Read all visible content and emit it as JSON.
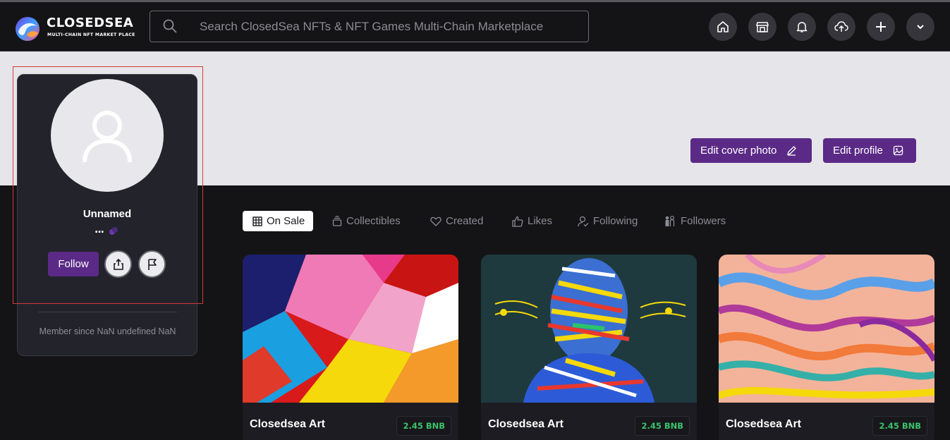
{
  "header": {
    "logo_title": "CLOSEDSEA",
    "logo_subtitle": "MULTI-CHAIN NFT MARKET PLACE",
    "search_placeholder": "Search ClosedSea NFTs & NFT Games Multi-Chain Marketplace",
    "nav_icons": [
      "home-icon",
      "store-icon",
      "bell-icon",
      "upload-cloud-icon",
      "plus-icon",
      "chevron-down-icon"
    ]
  },
  "cover": {
    "edit_cover_label": "Edit cover photo",
    "edit_profile_label": "Edit profile"
  },
  "profile": {
    "name": "Unnamed",
    "address": "...",
    "follow_label": "Follow",
    "member_since": "Member since NaN undefined NaN"
  },
  "tabs": [
    {
      "label": "On Sale",
      "icon": "grid-icon",
      "active": true
    },
    {
      "label": "Collectibles",
      "icon": "collection-icon"
    },
    {
      "label": "Created",
      "icon": "heart-icon"
    },
    {
      "label": "Likes",
      "icon": "thumbs-up-icon"
    },
    {
      "label": "Following",
      "icon": "user-check-icon"
    },
    {
      "label": "Followers",
      "icon": "users-icon"
    }
  ],
  "items": [
    {
      "name": "Closedsea Art",
      "price": "2.45 BNB"
    },
    {
      "name": "Closedsea Art",
      "price": "2.45 BNB"
    },
    {
      "name": "Closedsea Art",
      "price": "2.45 BNB"
    }
  ],
  "colors": {
    "accent": "#5b2a86",
    "price_green": "#3cc36a",
    "background": "#141416",
    "card": "#23232b",
    "cover": "#e6e6ea"
  }
}
